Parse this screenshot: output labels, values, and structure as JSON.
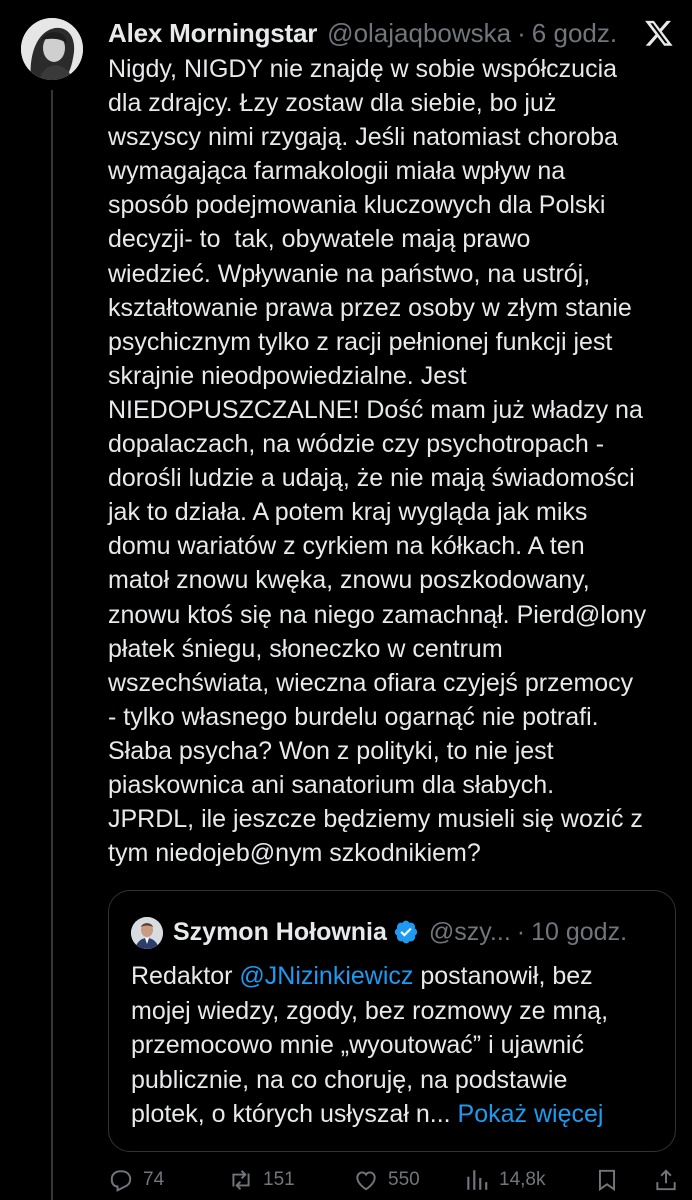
{
  "author": {
    "name": "Alex Morningstar",
    "handle": "@olajaqbowska",
    "time": "6 godz."
  },
  "tweet": {
    "lines": [
      "Nigdy, NIGDY nie znajdę w sobie współczucia",
      "dla zdrajcy. Łzy zostaw dla siebie, bo już",
      "wszyscy nimi rzygają. Jeśli natomiast choroba",
      "wymagająca farmakologii miała wpływ na",
      "sposób podejmowania kluczowych dla Polski",
      "decyzji- to  tak, obywatele mają prawo",
      "wiedzieć. Wpływanie na państwo, na ustrój,",
      "kształtowanie prawa przez osoby w złym stanie",
      "psychicznym tylko z racji pełnionej funkcji jest",
      "skrajnie nieodpowiedzialne. Jest",
      "NIEDOPUSZCZALNE! Dość mam już władzy na",
      "dopalaczach, na wódzie czy psychotropach -",
      "dorośli ludzie a udają, że nie mają świadomości",
      "jak to działa. A potem kraj wygląda jak miks",
      "domu wariatów z cyrkiem na kółkach. A ten",
      "matoł znowu kwęka, znowu poszkodowany,",
      "znowu ktoś się na niego zamachnął. Pierd@lony",
      "płatek śniegu, słoneczko w centrum",
      "wszechświata, wieczna ofiara czyjejś przemocy",
      "- tylko własnego burdelu ogarnąć nie potrafi.",
      "Słaba psycha? Won z polityki, to nie jest",
      "piaskownica ani sanatorium dla słabych.",
      "JPRDL, ile jeszcze będziemy musieli się wozić z",
      "tym niedojeb@nym szkodnikiem?"
    ]
  },
  "quote": {
    "name": "Szymon Hołownia",
    "handle": "@szy...",
    "time": "10 godz.",
    "line1_prefix": "Redaktor ",
    "mention": "@JNizinkiewicz",
    "line1_suffix": " postanowił, bez",
    "line2": "mojej wiedzy, zgody, bez rozmowy ze mną,",
    "line3": "przemocowo mnie „wyoutować” i ujawnić",
    "line4": "publicznie, na co choruję, na podstawie",
    "line5": "plotek, o których usłyszał n...",
    "more": "Pokaż więcej"
  },
  "actions": {
    "replies": "74",
    "reposts": "151",
    "likes": "550",
    "views": "14,8k"
  },
  "icons": {
    "logo": "x-logo-icon",
    "verified": "verified-badge-icon",
    "reply": "reply-icon",
    "repost": "repost-icon",
    "like": "heart-icon",
    "views": "views-icon",
    "bookmark": "bookmark-icon",
    "share": "share-icon"
  },
  "colors": {
    "background": "#000000",
    "text": "#e7e9ea",
    "muted": "#71767b",
    "link": "#1d9bf0",
    "border": "#2f3336"
  }
}
